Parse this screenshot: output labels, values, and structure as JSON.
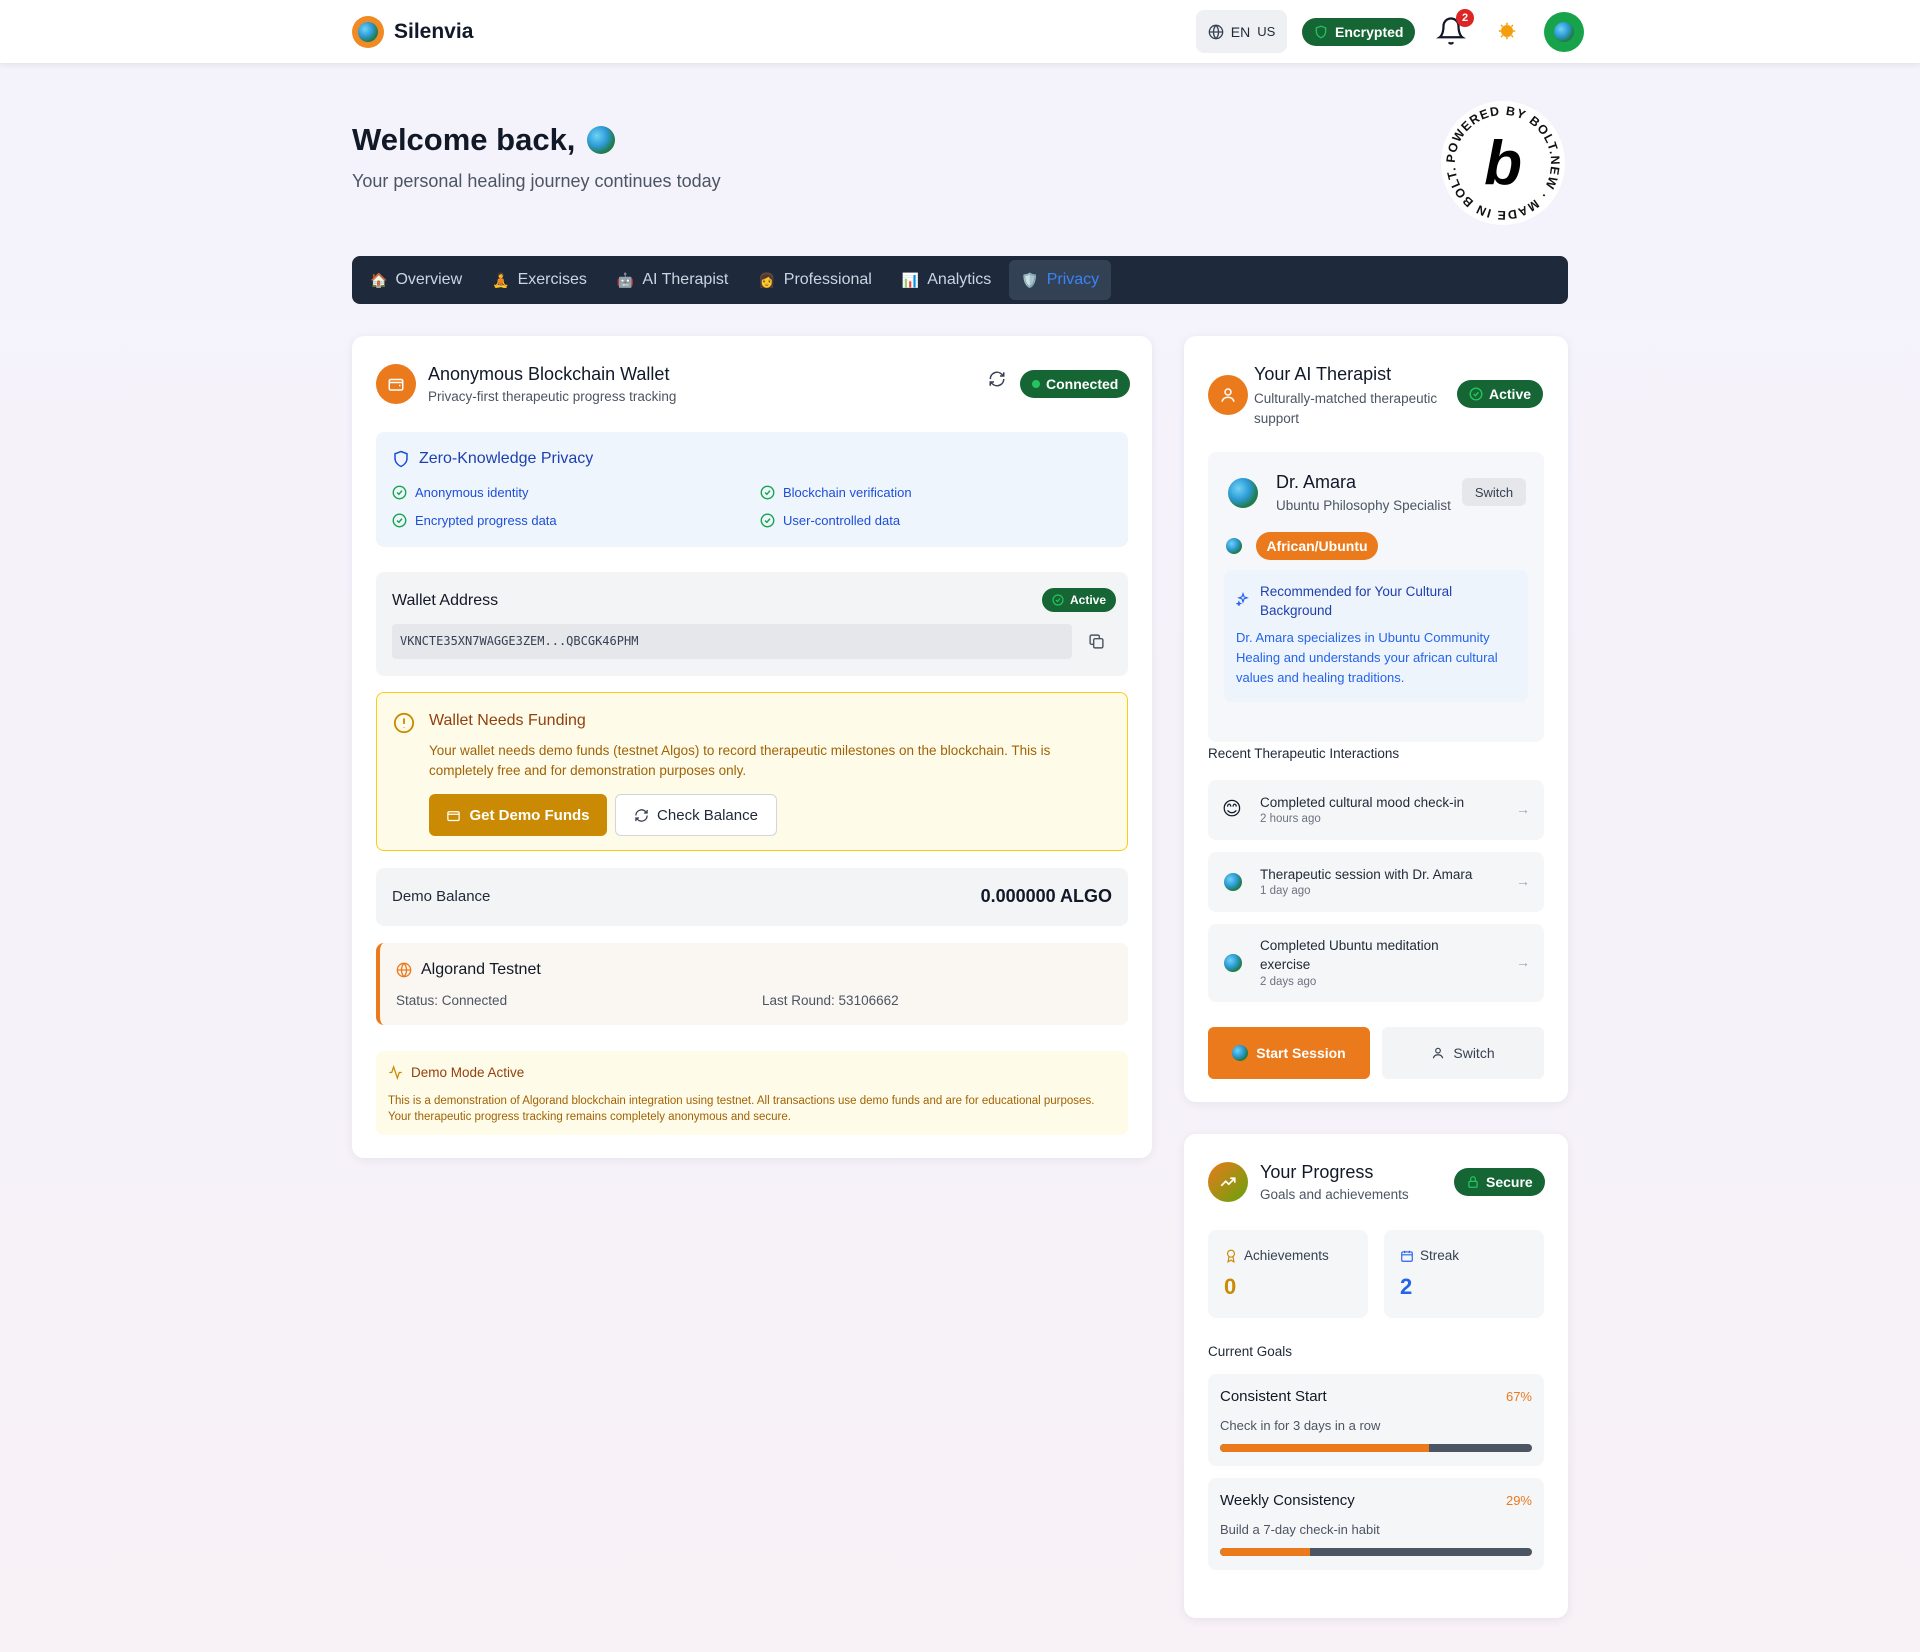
{
  "header": {
    "brand": "Silenvia",
    "lang": "EN",
    "region": "US",
    "encrypted_label": "Encrypted",
    "notifications_count": "2"
  },
  "welcome": {
    "title": "Welcome back,",
    "subtitle": "Your personal healing journey continues today"
  },
  "badge": {
    "text": "POWERED BY BOLT.NEW · MADE IN BOLT.NEW ·"
  },
  "tabs": [
    {
      "label": "Overview",
      "icon": "house-icon"
    },
    {
      "label": "Exercises",
      "icon": "meditation-icon"
    },
    {
      "label": "AI Therapist",
      "icon": "robot-icon"
    },
    {
      "label": "Professional",
      "icon": "person-icon"
    },
    {
      "label": "Analytics",
      "icon": "chart-icon"
    },
    {
      "label": "Privacy",
      "icon": "shield-icon",
      "active": true
    }
  ],
  "wallet": {
    "title": "Anonymous Blockchain Wallet",
    "subtitle": "Privacy-first therapeutic progress tracking",
    "status": "Connected",
    "zk": {
      "title": "Zero-Knowledge Privacy",
      "items": [
        "Anonymous identity",
        "Blockchain verification",
        "Encrypted progress data",
        "User-controlled data"
      ]
    },
    "address_label": "Wallet Address",
    "address_status": "Active",
    "address": "VKNCTE35XN7WAGGE3ZEM...QBCGK46PHM",
    "funding": {
      "title": "Wallet Needs Funding",
      "text": "Your wallet needs demo funds (testnet Algos) to record therapeutic milestones on the blockchain. This is completely free and for demonstration purposes only.",
      "get_funds": "Get Demo Funds",
      "check_balance": "Check Balance"
    },
    "balance_label": "Demo Balance",
    "balance_value": "0.000000 ALGO",
    "network": {
      "name": "Algorand Testnet",
      "status": "Status: Connected",
      "last_round": "Last Round: 53106662"
    },
    "demo": {
      "title": "Demo Mode Active",
      "text": "This is a demonstration of Algorand blockchain integration using testnet. All transactions use demo funds and are for educational purposes. Your therapeutic progress tracking remains completely anonymous and secure."
    }
  },
  "therapist": {
    "title": "Your AI Therapist",
    "subtitle": "Culturally-matched therapeutic support",
    "status": "Active",
    "name": "Dr. Amara",
    "specialty": "Ubuntu Philosophy Specialist",
    "switch_small": "Switch",
    "culture": "African/Ubuntu",
    "rec_title": "Recommended for Your Cultural Background",
    "rec_text": "Dr. Amara specializes in Ubuntu Community Healing and understands your african cultural values and healing traditions.",
    "recent_label": "Recent Therapeutic Interactions",
    "interactions": [
      {
        "title": "Completed cultural mood check-in",
        "time": "2 hours ago",
        "icon": "smile-emoji-icon"
      },
      {
        "title": "Therapeutic session with Dr. Amara",
        "time": "1 day ago",
        "icon": "globe-icon"
      },
      {
        "title": "Completed Ubuntu meditation exercise",
        "time": "2 days ago",
        "icon": "globe-icon"
      }
    ],
    "start_session": "Start Session",
    "switch": "Switch"
  },
  "progress": {
    "title": "Your Progress",
    "subtitle": "Goals and achievements",
    "status": "Secure",
    "achievements_label": "Achievements",
    "achievements_value": "0",
    "streak_label": "Streak",
    "streak_value": "2",
    "goals_label": "Current Goals",
    "goals": [
      {
        "title": "Consistent Start",
        "pct_label": "67%",
        "desc": "Check in for 3 days in a row",
        "progress": 0.67
      },
      {
        "title": "Weekly Consistency",
        "pct_label": "29%",
        "desc": "Build a 7-day check-in habit",
        "progress": 0.29
      }
    ]
  },
  "colors": {
    "accent_orange": "#ea7a1c",
    "success_green": "#166534",
    "nav_dark": "#1e293b",
    "active_tab_blue": "#3b82f6"
  }
}
